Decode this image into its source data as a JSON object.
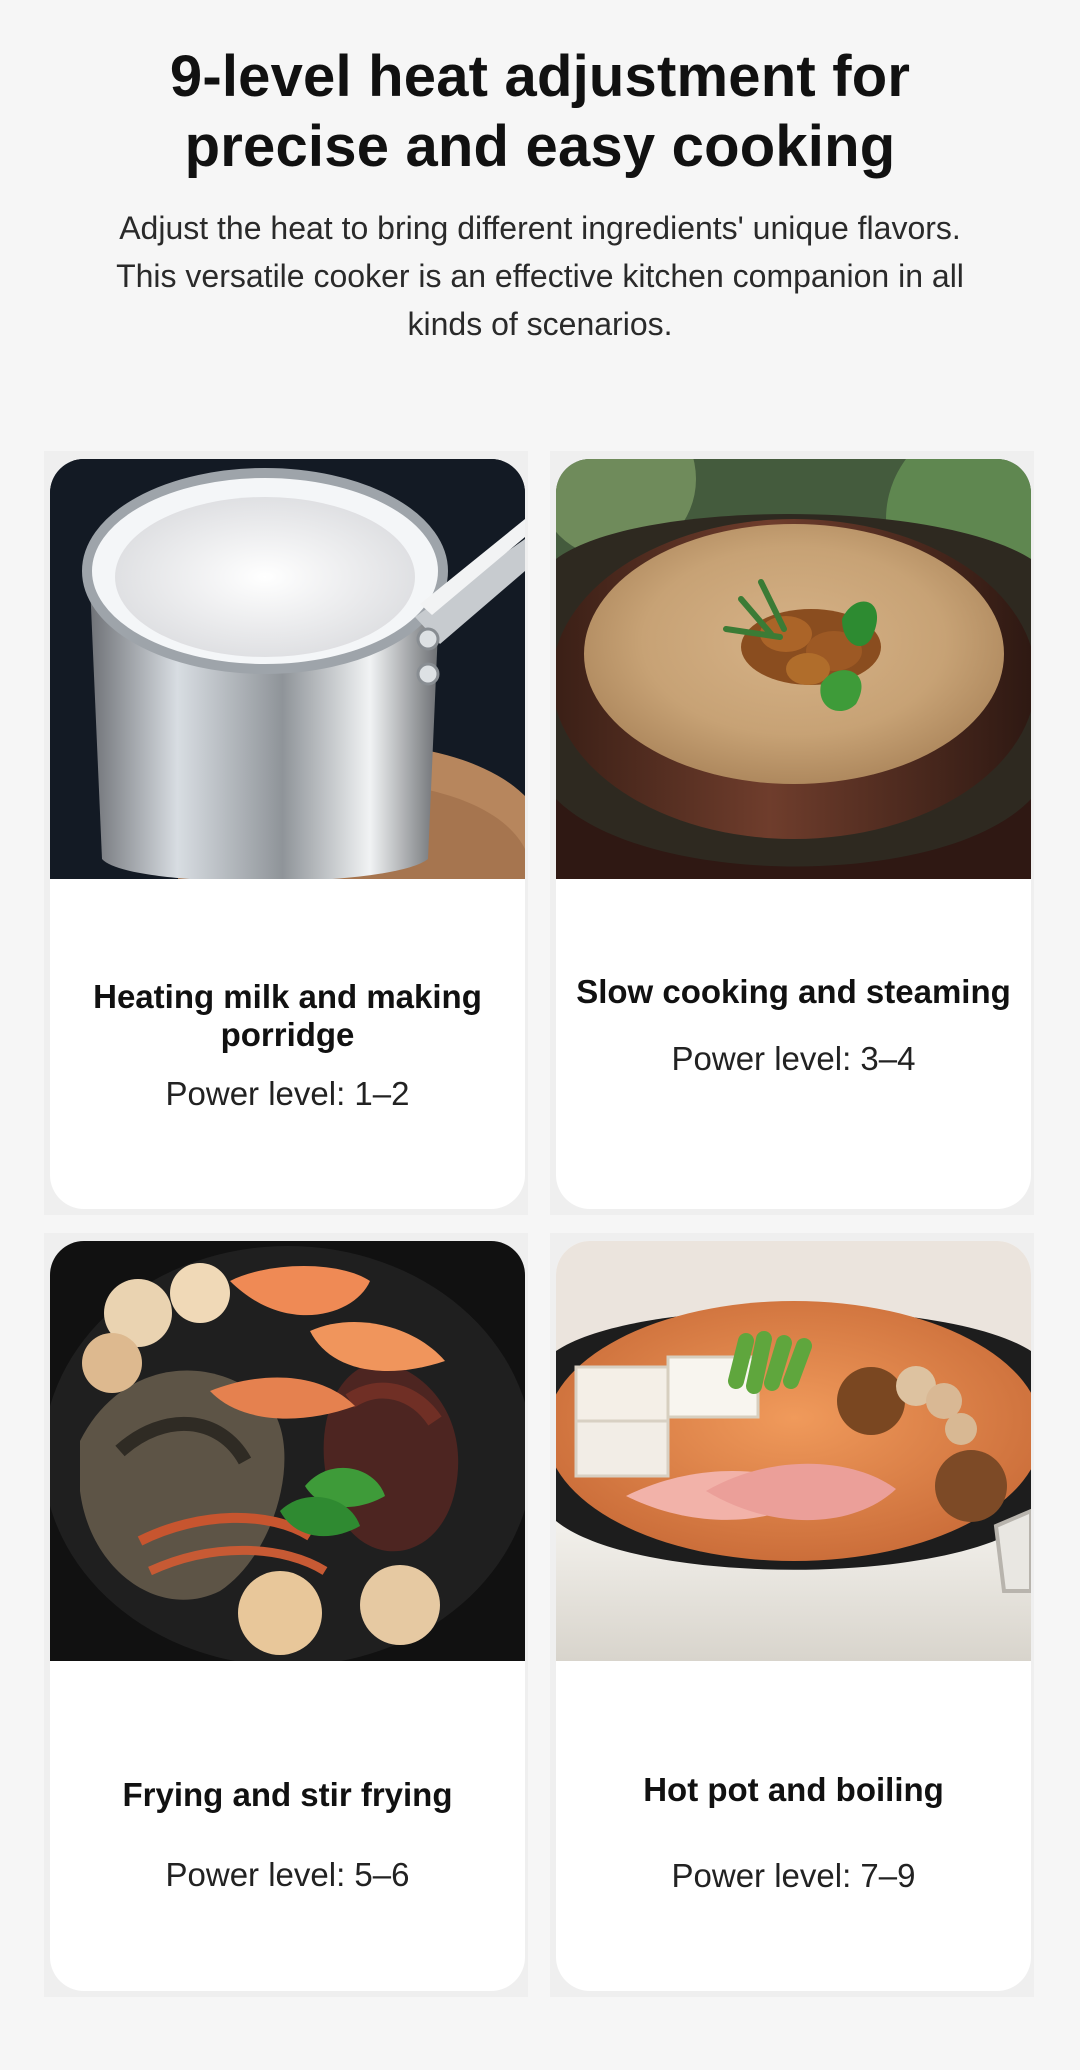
{
  "header": {
    "title": "9-level heat adjustment for precise and easy cooking",
    "subtitle": "Adjust the heat to bring different ingredients' unique flavors. This versatile cooker is an effective kitchen companion in all kinds of scenarios."
  },
  "cards": [
    {
      "title": "Heating milk and making porridge",
      "power": "Power level: 1–2"
    },
    {
      "title": "Slow cooking and steaming",
      "power": "Power level: 3–4"
    },
    {
      "title": "Frying and stir frying",
      "power": "Power level: 5–6"
    },
    {
      "title": "Hot pot and boiling",
      "power": "Power level: 7–9"
    }
  ],
  "colors": {
    "background": "#f6f6f6",
    "card": "#ffffff",
    "title_text": "#111111",
    "body_text": "#222222"
  }
}
